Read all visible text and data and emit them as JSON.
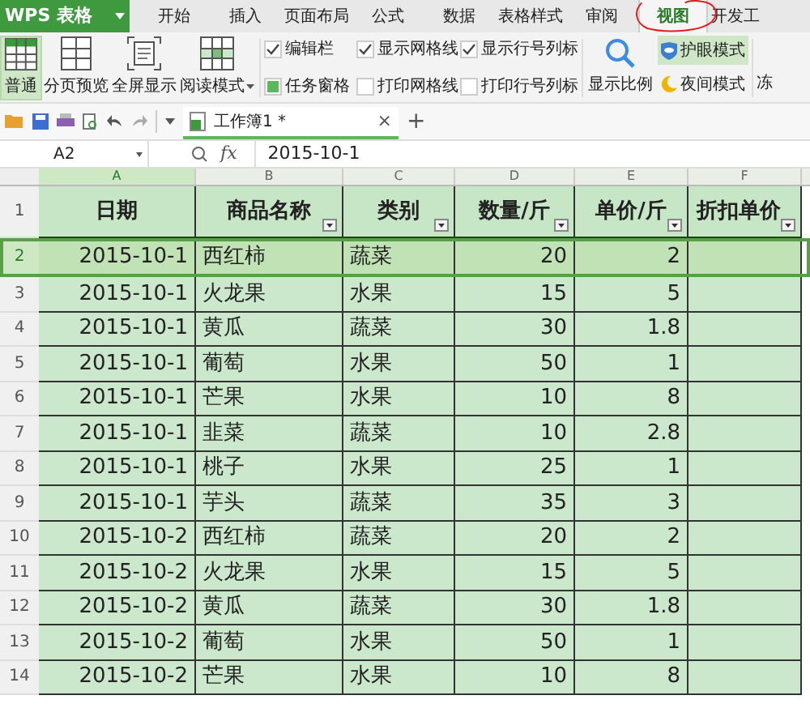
{
  "app": {
    "logo": "WPS 表格"
  },
  "menu_tabs": [
    {
      "label": "开始",
      "selected": false
    },
    {
      "label": "插入",
      "selected": false
    },
    {
      "label": "页面布局",
      "selected": false
    },
    {
      "label": "公式",
      "selected": false
    },
    {
      "label": "数据",
      "selected": false
    },
    {
      "label": "表格样式",
      "selected": false
    },
    {
      "label": "审阅",
      "selected": false
    },
    {
      "label": "视图",
      "selected": true
    },
    {
      "label": "开发工",
      "selected": false
    }
  ],
  "ribbon": {
    "view_buttons": [
      {
        "label": "普通",
        "selected": true,
        "kind": "normal"
      },
      {
        "label": "分页预览",
        "selected": false,
        "kind": "page"
      },
      {
        "label": "全屏显示",
        "selected": false,
        "kind": "full"
      },
      {
        "label": "阅读模式",
        "selected": false,
        "kind": "read"
      }
    ],
    "checkboxes": [
      {
        "label": "编辑栏",
        "checked": true,
        "kind": "tick"
      },
      {
        "label": "任务窗格",
        "checked": true,
        "kind": "fill"
      },
      {
        "label": "显示网格线",
        "checked": true,
        "kind": "tick"
      },
      {
        "label": "打印网格线",
        "checked": false,
        "kind": "tick"
      },
      {
        "label": "显示行号列标",
        "checked": true,
        "kind": "tick"
      },
      {
        "label": "打印行号列标",
        "checked": false,
        "kind": "tick"
      }
    ],
    "zoom_button": "显示比例",
    "eye_mode": {
      "label": "护眼模式",
      "on": true
    },
    "night_mode": {
      "label": "夜间模式"
    },
    "freeze": "冻"
  },
  "document_tab": {
    "label": "工作簿1 *",
    "close": "×",
    "add": "+"
  },
  "formula_bar": {
    "cell": "A2",
    "fx": "fx",
    "formula": "2015-10-1"
  },
  "sheet": {
    "columns": [
      {
        "label": "A",
        "selected": true
      },
      {
        "label": "B",
        "selected": false
      },
      {
        "label": "C",
        "selected": false
      },
      {
        "label": "D",
        "selected": false
      },
      {
        "label": "E",
        "selected": false
      },
      {
        "label": "F",
        "selected": false
      }
    ],
    "header_row_number": "1",
    "header": [
      "日期",
      "商品名称",
      "类别",
      "数量/斤",
      "单价/斤",
      "折扣单价"
    ],
    "rows": [
      {
        "number": "2",
        "selected": true,
        "cells": [
          "2015-10-1",
          "西红柿",
          "蔬菜",
          "20",
          "2",
          ""
        ]
      },
      {
        "number": "3",
        "selected": false,
        "cells": [
          "2015-10-1",
          "火龙果",
          "水果",
          "15",
          "5",
          ""
        ]
      },
      {
        "number": "4",
        "selected": false,
        "cells": [
          "2015-10-1",
          "黄瓜",
          "蔬菜",
          "30",
          "1.8",
          ""
        ]
      },
      {
        "number": "5",
        "selected": false,
        "cells": [
          "2015-10-1",
          "葡萄",
          "水果",
          "50",
          "1",
          ""
        ]
      },
      {
        "number": "6",
        "selected": false,
        "cells": [
          "2015-10-1",
          "芒果",
          "水果",
          "10",
          "8",
          ""
        ]
      },
      {
        "number": "7",
        "selected": false,
        "cells": [
          "2015-10-1",
          "韭菜",
          "蔬菜",
          "10",
          "2.8",
          ""
        ]
      },
      {
        "number": "8",
        "selected": false,
        "cells": [
          "2015-10-1",
          "桃子",
          "水果",
          "25",
          "1",
          ""
        ]
      },
      {
        "number": "9",
        "selected": false,
        "cells": [
          "2015-10-1",
          "芋头",
          "蔬菜",
          "35",
          "3",
          ""
        ]
      },
      {
        "number": "10",
        "selected": false,
        "cells": [
          "2015-10-2",
          "西红柿",
          "蔬菜",
          "20",
          "2",
          ""
        ]
      },
      {
        "number": "11",
        "selected": false,
        "cells": [
          "2015-10-2",
          "火龙果",
          "水果",
          "15",
          "5",
          ""
        ]
      },
      {
        "number": "12",
        "selected": false,
        "cells": [
          "2015-10-2",
          "黄瓜",
          "蔬菜",
          "30",
          "1.8",
          ""
        ]
      },
      {
        "number": "13",
        "selected": false,
        "cells": [
          "2015-10-2",
          "葡萄",
          "水果",
          "50",
          "1",
          ""
        ]
      },
      {
        "number": "14",
        "selected": false,
        "cells": [
          "2015-10-2",
          "芒果",
          "水果",
          "10",
          "8",
          ""
        ]
      }
    ]
  }
}
